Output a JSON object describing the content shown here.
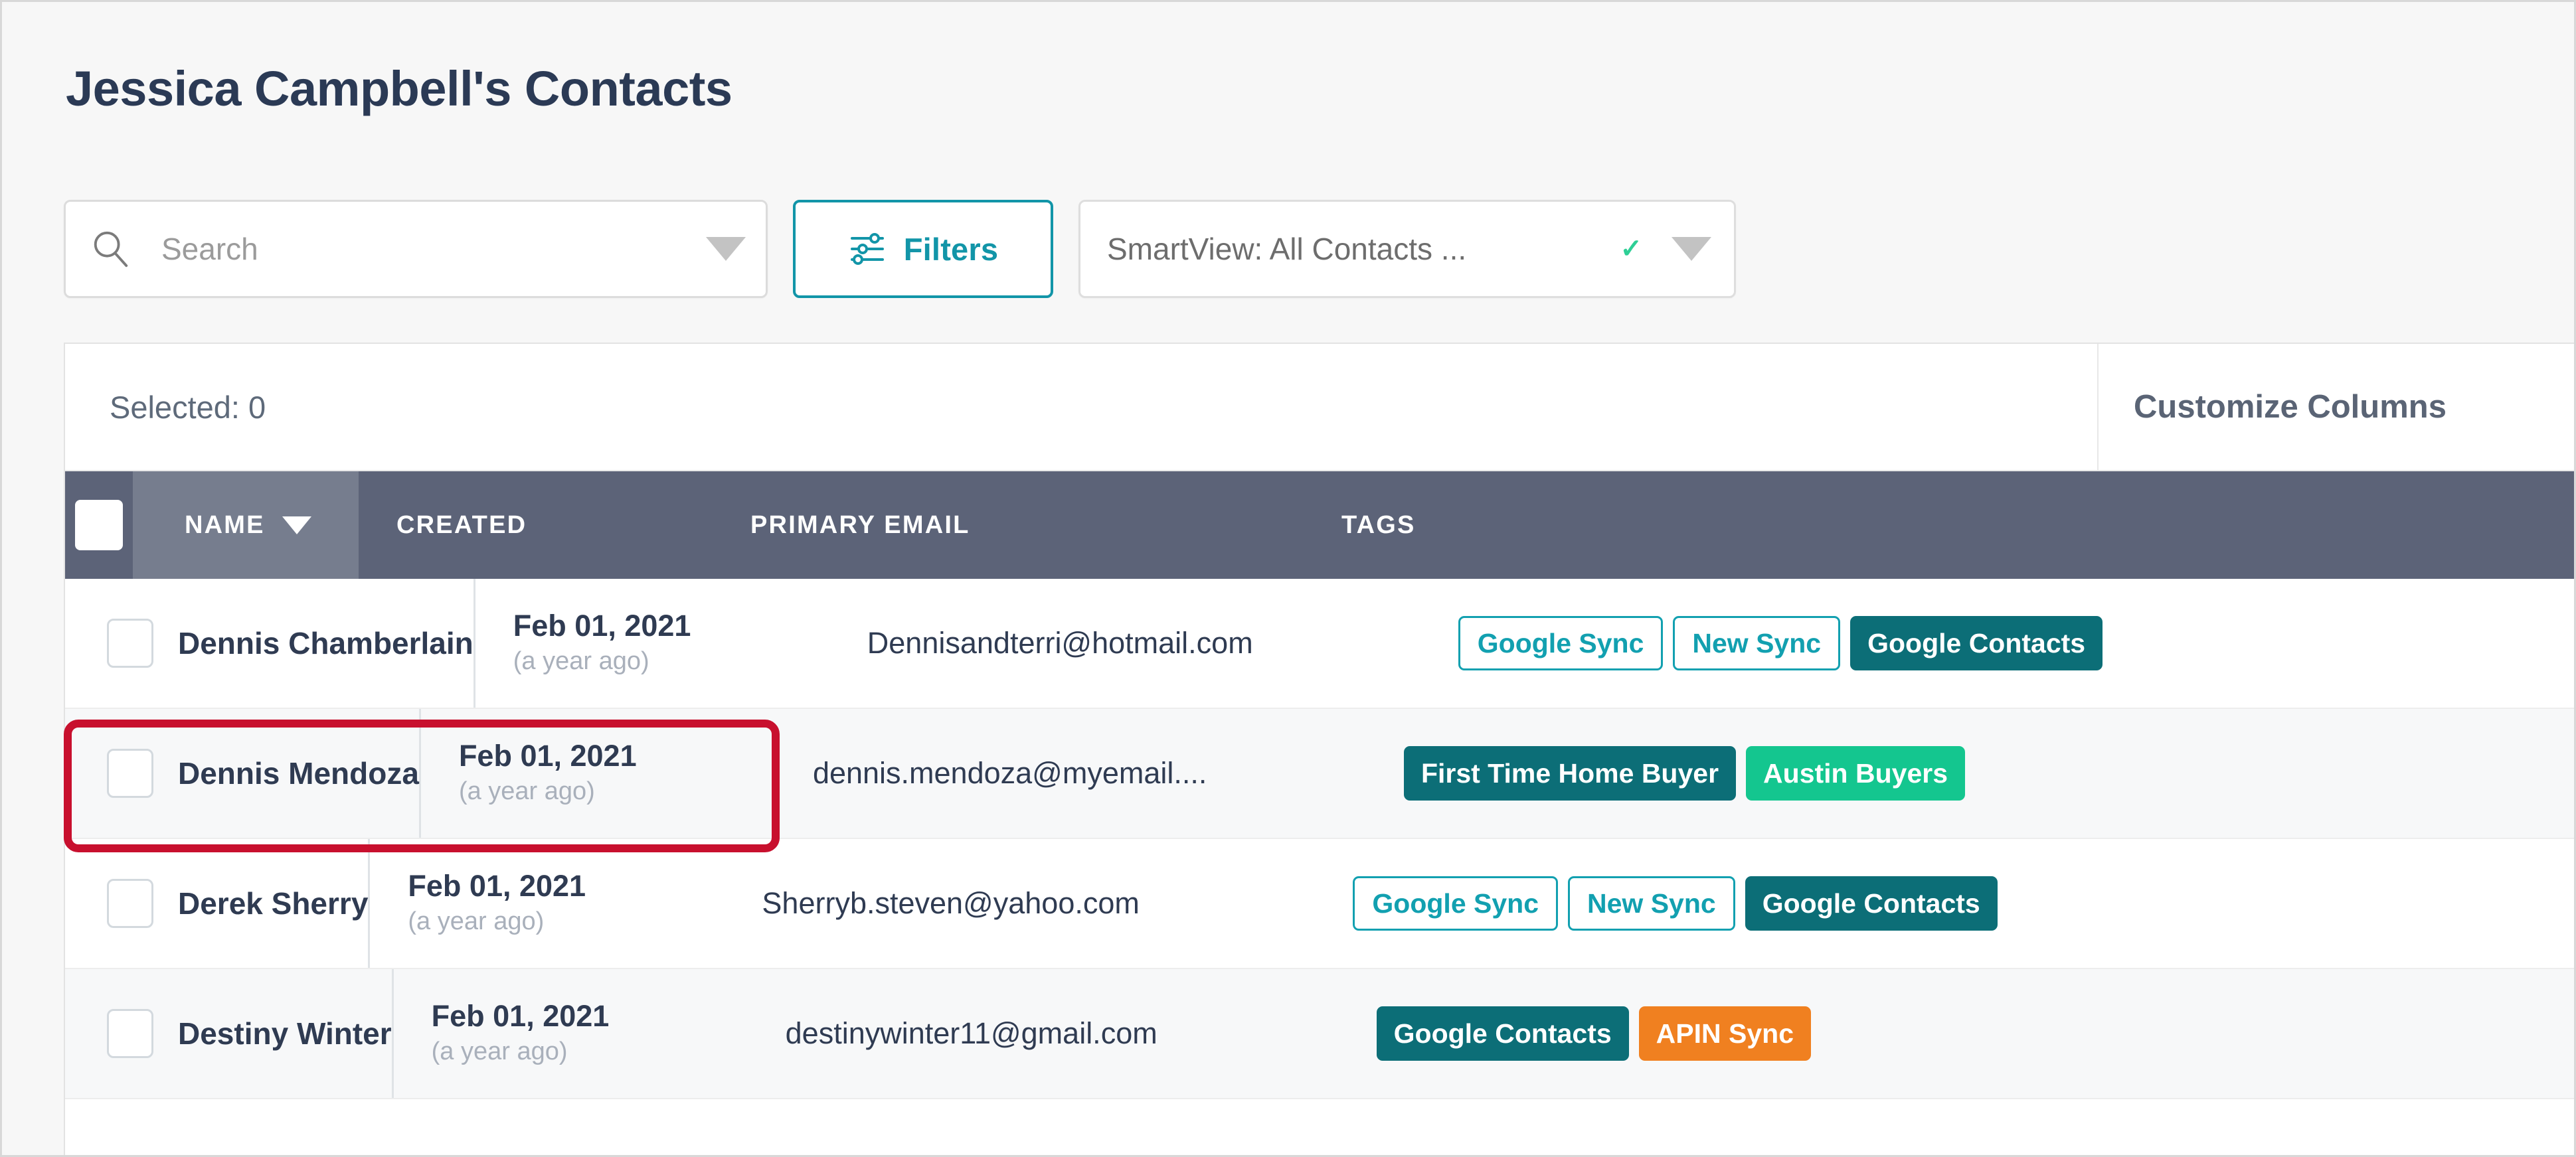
{
  "header": {
    "title": "Jessica Campbell's Contacts"
  },
  "toolbar": {
    "search": {
      "placeholder": "Search",
      "value": "",
      "icon": "search-icon",
      "caret_icon": "chevron-down-icon"
    },
    "filters": {
      "label": "Filters",
      "icon": "filters-sliders-icon"
    },
    "smartview": {
      "label": "SmartView: All Contacts ...",
      "check_glyph": "✓",
      "caret_icon": "chevron-down-icon"
    }
  },
  "table": {
    "selected_label": "Selected: 0",
    "customize_columns_label": "Customize Columns",
    "columns": [
      {
        "key": "check",
        "label": ""
      },
      {
        "key": "name",
        "label": "NAME",
        "sorted": true,
        "sort_dir": "desc"
      },
      {
        "key": "created",
        "label": "CREATED"
      },
      {
        "key": "email",
        "label": "PRIMARY EMAIL"
      },
      {
        "key": "tags",
        "label": "TAGS"
      }
    ],
    "rows": [
      {
        "name": "Dennis Chamberlain",
        "created_date": "Feb 01, 2021",
        "created_relative": "(a year ago)",
        "email": "Dennisandterri@hotmail.com",
        "tags": [
          {
            "label": "Google Sync",
            "style": "outline"
          },
          {
            "label": "New Sync",
            "style": "outline"
          },
          {
            "label": "Google Contacts",
            "style": "teal"
          }
        ]
      },
      {
        "name": "Dennis Mendoza",
        "created_date": "Feb 01, 2021",
        "created_relative": "(a year ago)",
        "email": "dennis.mendoza@myemail....",
        "tags": [
          {
            "label": "First Time Home Buyer",
            "style": "teal"
          },
          {
            "label": "Austin Buyers",
            "style": "green"
          }
        ]
      },
      {
        "name": "Derek Sherry",
        "created_date": "Feb 01, 2021",
        "created_relative": "(a year ago)",
        "email": "Sherryb.steven@yahoo.com",
        "tags": [
          {
            "label": "Google Sync",
            "style": "outline"
          },
          {
            "label": "New Sync",
            "style": "outline"
          },
          {
            "label": "Google Contacts",
            "style": "teal"
          }
        ]
      },
      {
        "name": "Destiny Winter",
        "created_date": "Feb 01, 2021",
        "created_relative": "(a year ago)",
        "email": "destinywinter11@gmail.com",
        "tags": [
          {
            "label": "Google Contacts",
            "style": "teal"
          },
          {
            "label": "APIN Sync",
            "style": "orange"
          }
        ]
      }
    ]
  },
  "annotation": {
    "highlight_target": "Dennis Mendoza",
    "color": "#c8102e"
  },
  "colors": {
    "title": "#2b3a55",
    "accent_teal": "#1295a8",
    "header_dark": "#5c6378",
    "header_sorted": "#767d8e",
    "tag_teal": "#0c6e77",
    "tag_green": "#14c68f",
    "tag_orange": "#f08020",
    "annotation_red": "#c8102e"
  }
}
